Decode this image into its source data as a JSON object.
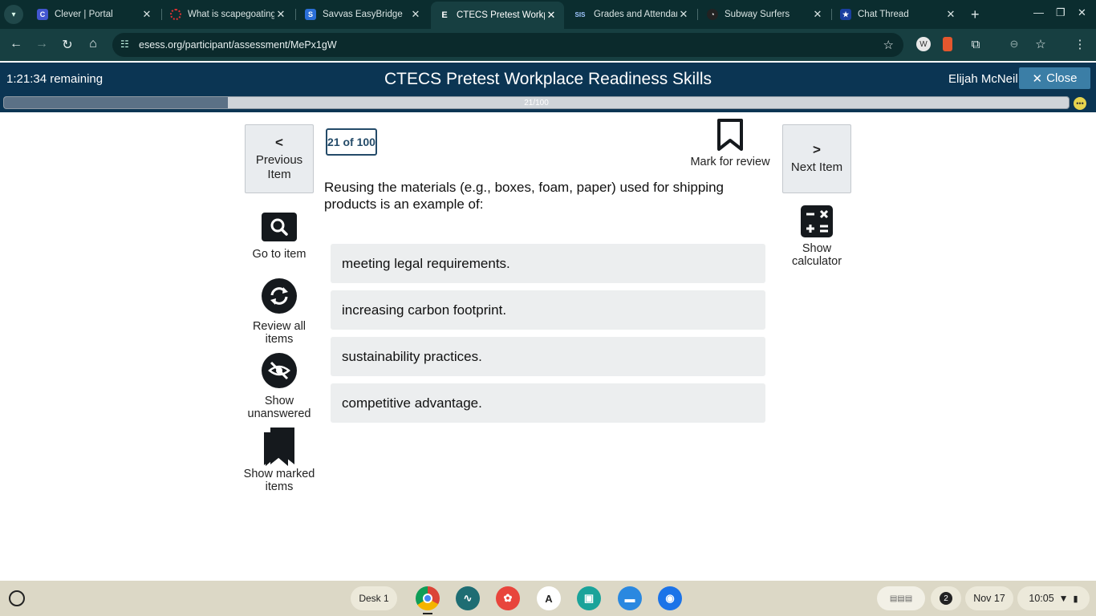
{
  "browser": {
    "tabs": [
      {
        "title": "Clever | Portal",
        "favicon": "C",
        "favicon_bg": "#4256d0",
        "favicon_fg": "#ffffff",
        "active": false
      },
      {
        "title": "What is scapegoating",
        "favicon": "",
        "favicon_bg": "transparent",
        "favicon_fg": "#d33",
        "active": false
      },
      {
        "title": "Savvas EasyBridge",
        "favicon": "S",
        "favicon_bg": "#2b6fd8",
        "favicon_fg": "#ffffff",
        "active": false
      },
      {
        "title": "CTECS Pretest Workp",
        "favicon": "E",
        "favicon_bg": "transparent",
        "favicon_fg": "#ffffff",
        "active": true
      },
      {
        "title": "Grades and Attendan",
        "favicon": "SIS",
        "favicon_bg": "transparent",
        "favicon_fg": "#9fc6ff",
        "active": false
      },
      {
        "title": "Subway Surfers",
        "favicon": "",
        "favicon_bg": "#222222",
        "favicon_fg": "#ffffff",
        "active": false
      },
      {
        "title": "Chat Thread",
        "favicon": "★",
        "favicon_bg": "#1a3fa0",
        "favicon_fg": "#ffffff",
        "active": false
      }
    ],
    "url": "esess.org/participant/assessment/MePx1gW"
  },
  "header": {
    "time_remaining": "1:21:34 remaining",
    "exam_title": "CTECS Pretest Workplace Readiness Skills",
    "user_name": "Elijah McNeil",
    "close_label": "Close"
  },
  "progress": {
    "label": "21/100",
    "current": 21,
    "total": 100
  },
  "question_panel": {
    "previous_label": "Previous Item",
    "next_label": "Next Item",
    "counter": "21 of 100",
    "mark_for_review": "Mark for review",
    "question_text": "Reusing the materials (e.g., boxes, foam, paper) used for shipping products is an example of:",
    "answers": [
      "meeting legal requirements.",
      "increasing carbon footprint.",
      "sustainability practices.",
      "competitive advantage."
    ]
  },
  "tools": {
    "go_to_item": "Go to item",
    "review_all": "Review all items",
    "show_unanswered": "Show unanswered",
    "show_marked": "Show marked items",
    "show_calculator": "Show calculator"
  },
  "shelf": {
    "desk_label": "Desk 1",
    "notification_count": "2",
    "date": "Nov 17",
    "time": "10:05"
  },
  "colors": {
    "header_bg": "#0b3553",
    "close_button": "#3b7ea6",
    "answer_bg": "#eceeef",
    "counter_border": "#244b69"
  }
}
